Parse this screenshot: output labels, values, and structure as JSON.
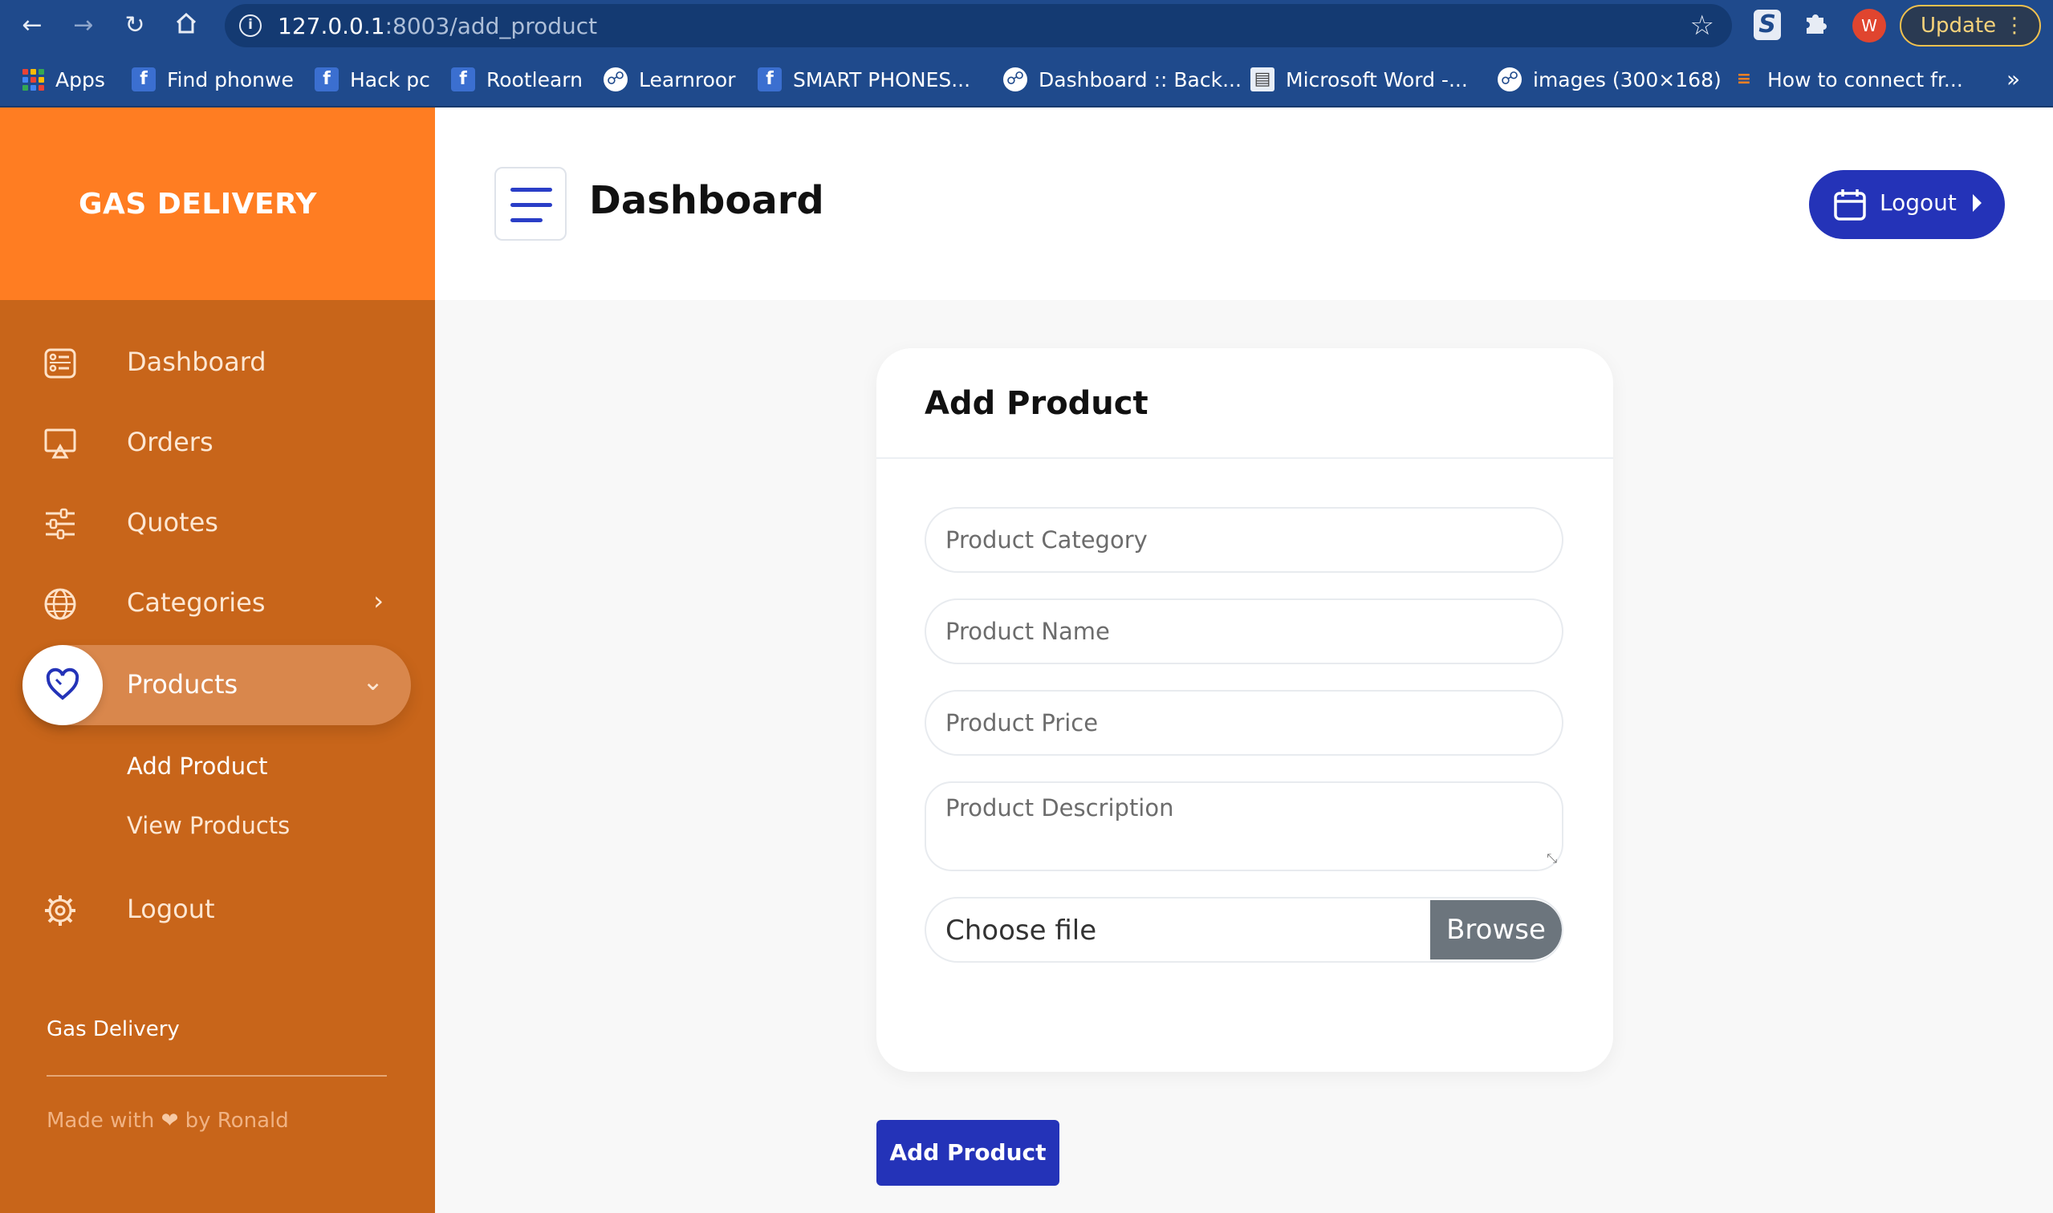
{
  "browser": {
    "url_host": "127.0.0.1",
    "url_path": ":8003/add_product",
    "update_label": "Update",
    "avatar_letter": "W",
    "bookmarks": [
      {
        "label": "Apps",
        "icon": "apps-grid-icon"
      },
      {
        "label": "Find phonwe",
        "icon": "facebook-icon"
      },
      {
        "label": "Hack pc",
        "icon": "facebook-icon"
      },
      {
        "label": "Rootlearn",
        "icon": "facebook-icon"
      },
      {
        "label": "Learnroor",
        "icon": "globe-icon"
      },
      {
        "label": "SMART PHONES...",
        "icon": "facebook-icon"
      },
      {
        "label": "Dashboard :: Back...",
        "icon": "globe-icon"
      },
      {
        "label": "Microsoft Word -...",
        "icon": "document-icon"
      },
      {
        "label": "images (300×168)",
        "icon": "globe-icon"
      },
      {
        "label": "How to connect fr...",
        "icon": "stackoverflow-icon"
      }
    ],
    "more_label": "»"
  },
  "sidebar": {
    "brand": "GAS DELIVERY",
    "items": [
      {
        "label": "Dashboard",
        "icon": "dashboard-icon"
      },
      {
        "label": "Orders",
        "icon": "monitor-icon"
      },
      {
        "label": "Quotes",
        "icon": "sliders-icon"
      },
      {
        "label": "Categories",
        "icon": "globe-icon"
      },
      {
        "label": "Products",
        "icon": "heart-icon"
      },
      {
        "label": "Logout",
        "icon": "gear-icon"
      }
    ],
    "sub_items": [
      {
        "label": "Add Product"
      },
      {
        "label": "View Products"
      }
    ],
    "footer_title": "Gas Delivery",
    "footer_made_prefix": "Made with",
    "footer_made_suffix": "by Ronald"
  },
  "header": {
    "title": "Dashboard",
    "logout_label": "Logout"
  },
  "form": {
    "title": "Add Product",
    "category_placeholder": "Product Category",
    "name_placeholder": "Product Name",
    "price_placeholder": "Product Price",
    "description_placeholder": "Product Description",
    "file_label": "Choose file",
    "browse_label": "Browse",
    "submit_label": "Add Product"
  },
  "colors": {
    "brand_orange": "#ff7d22",
    "sidebar_orange": "#c8651a",
    "primary_blue": "#2433b8",
    "browser_blue": "#1f4a8c"
  }
}
